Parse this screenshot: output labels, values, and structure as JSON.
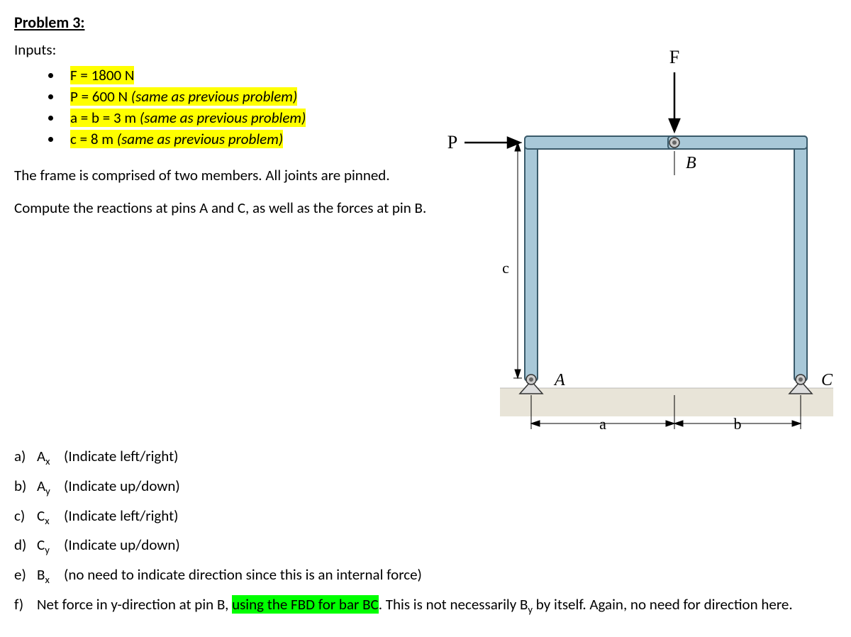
{
  "title": "Problem 3:",
  "inputs_label": "Inputs:",
  "inputs": [
    {
      "highlight": true,
      "text": "F = 1800 N",
      "suffix": ""
    },
    {
      "highlight": true,
      "text": "P = 600 N",
      "suffix": "  (same as previous problem)"
    },
    {
      "highlight": true,
      "text": "a = b = 3 m",
      "suffix": "  (same as previous problem)"
    },
    {
      "highlight": true,
      "text": "c = 8 m",
      "suffix": "  (same as previous problem)"
    }
  ],
  "desc1": "The frame is comprised of two members.  All joints are pinned.",
  "desc2": "Compute the reactions at pins A and C, as well as the forces at pin B.",
  "questions": {
    "a": {
      "var": "A",
      "sub": "x",
      "note": "(Indicate left/right)"
    },
    "b": {
      "var": "A",
      "sub": "y",
      "note": "(Indicate up/down)"
    },
    "c": {
      "var": "C",
      "sub": "x",
      "note": "(Indicate left/right)"
    },
    "d": {
      "var": "C",
      "sub": "y",
      "note": "(Indicate up/down)"
    },
    "e": {
      "var": "B",
      "sub": "x",
      "note": "(no need to indicate direction since this is an internal force)"
    },
    "f": {
      "pre": "Net force in y-direction at pin B, ",
      "hl": "using the FBD for bar BC",
      "post1": ".  This is not necessarily B",
      "post_sub": "y",
      "post2": " by itself.  Again, no need for direction here."
    }
  },
  "diagram": {
    "P": "P",
    "F": "F",
    "A": "A",
    "B": "B",
    "C": "C",
    "a": "a",
    "b": "b",
    "c": "c"
  }
}
